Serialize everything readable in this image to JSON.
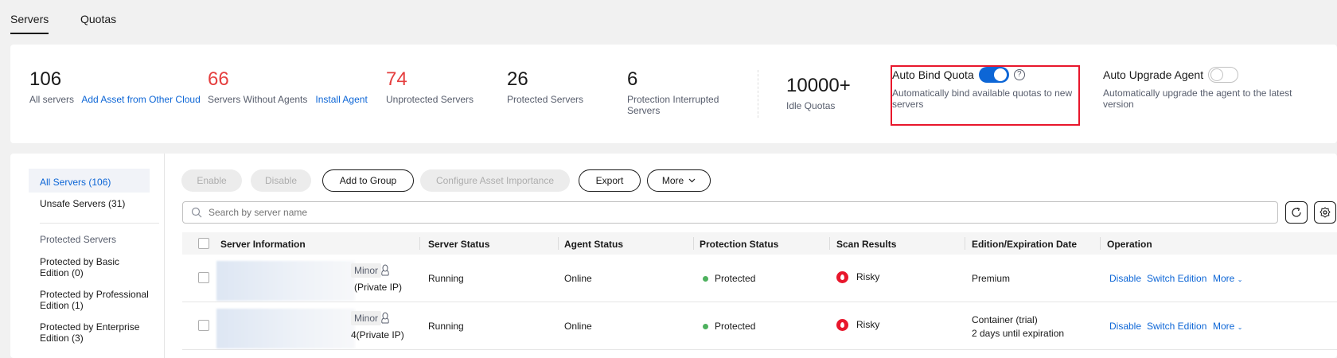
{
  "tabs": [
    {
      "label": "Servers",
      "active": true
    },
    {
      "label": "Quotas",
      "active": false
    }
  ],
  "stats": {
    "all_servers": {
      "value": "106",
      "label": "All servers",
      "link": "Add Asset from Other Cloud"
    },
    "without_agents": {
      "value": "66",
      "label": "Servers Without Agents",
      "link": "Install Agent"
    },
    "unprotected": {
      "value": "74",
      "label": "Unprotected Servers"
    },
    "protected": {
      "value": "26",
      "label": "Protected Servers"
    },
    "interrupted": {
      "value": "6",
      "label_line1": "Protection Interrupted",
      "label_line2": "Servers"
    },
    "idle": {
      "value": "10000+",
      "label": "Idle Quotas"
    },
    "auto_bind": {
      "title": "Auto Bind Quota",
      "enabled": true,
      "help": "?",
      "desc_line1": "Automatically bind available quotas to new",
      "desc_line2": "servers"
    },
    "auto_upgrade": {
      "title": "Auto Upgrade Agent",
      "enabled": false,
      "desc_line1": "Automatically upgrade the agent to the latest",
      "desc_line2": "version"
    }
  },
  "sidebar": {
    "all_servers": "All Servers (106)",
    "unsafe_servers": "Unsafe Servers (31)",
    "protected_header": "Protected Servers",
    "basic_line1": "Protected by Basic",
    "basic_line2": "Edition (0)",
    "professional_line1": "Protected by Professional",
    "professional_line2": "Edition (1)",
    "enterprise_line1": "Protected by Enterprise",
    "enterprise_line2": "Edition (3)"
  },
  "toolbar": {
    "enable": "Enable",
    "disable": "Disable",
    "add_to_group": "Add to Group",
    "configure": "Configure Asset Importance",
    "export": "Export",
    "more": "More"
  },
  "search": {
    "placeholder": "Search by server name"
  },
  "columns": [
    "Server Information",
    "Server Status",
    "Agent Status",
    "Protection Status",
    "Scan Results",
    "Edition/Expiration Date",
    "Operation"
  ],
  "rows": [
    {
      "tag": "Minor",
      "ip": "(Private IP)",
      "server_status": "Running",
      "agent_status": "Online",
      "protection": "Protected",
      "scan": "Risky",
      "edition_line1": "Premium",
      "edition_line2": "",
      "op_disable": "Disable",
      "op_switch": "Switch Edition",
      "op_more": "More"
    },
    {
      "tag": "Minor",
      "ip": "4(Private IP)",
      "server_status": "Running",
      "agent_status": "Online",
      "protection": "Protected",
      "scan": "Risky",
      "edition_line1": "Container (trial)",
      "edition_line2": "2 days until expiration",
      "op_disable": "Disable",
      "op_switch": "Switch Edition",
      "op_more": "More"
    }
  ],
  "colors": {
    "accent": "#0d66d6",
    "danger": "#e53e3e",
    "highlight_box": "#e8172c",
    "success": "#4eb15e"
  }
}
